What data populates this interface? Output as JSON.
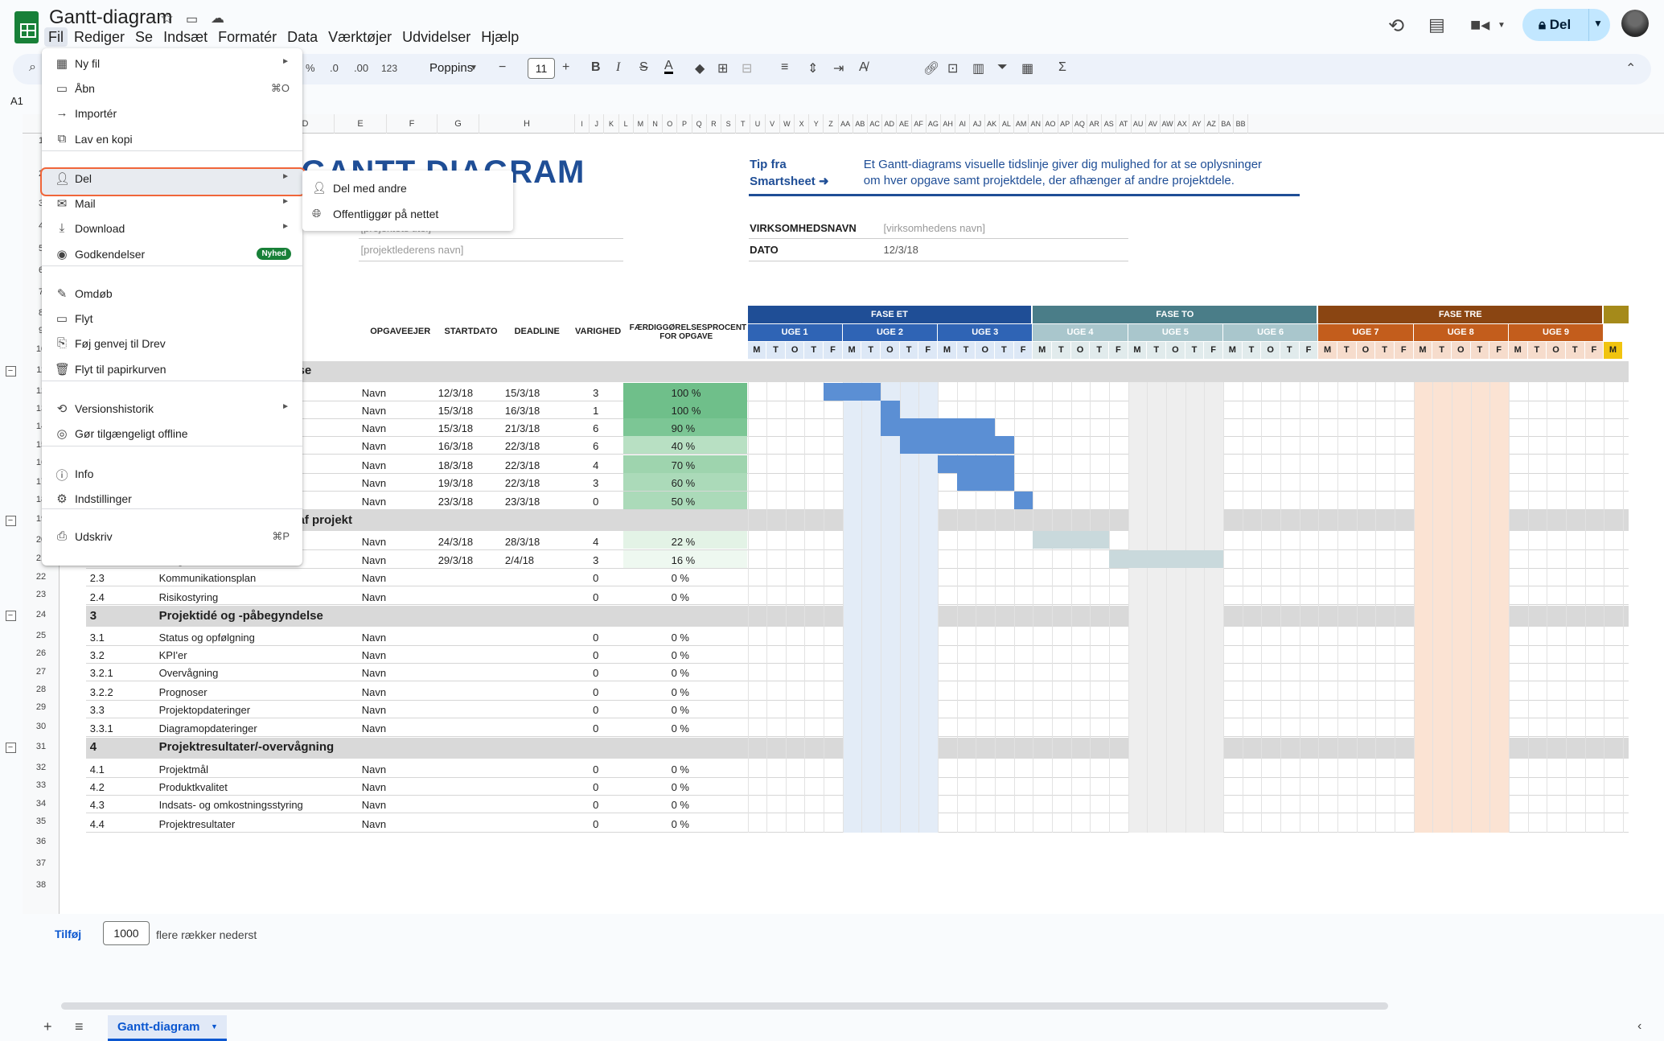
{
  "doc": {
    "title": "Gantt-diagram"
  },
  "menubar": [
    "Fil",
    "Rediger",
    "Se",
    "Indsæt",
    "Formatér",
    "Data",
    "Værktøjer",
    "Udvidelser",
    "Hjælp"
  ],
  "share": {
    "label": "Del"
  },
  "toolbar": {
    "percent": "%",
    "dec_less": ".0",
    "dec_more": ".00",
    "num": "123",
    "font": "Poppins",
    "size": "11",
    "minus": "−",
    "plus": "+"
  },
  "namebox": "A1",
  "columns": [
    "D",
    "E",
    "F",
    "G",
    "H",
    "I",
    "J",
    "K",
    "L",
    "M",
    "N",
    "O",
    "P",
    "Q",
    "R",
    "S",
    "T",
    "U",
    "V",
    "W",
    "X",
    "Y",
    "Z",
    "AA",
    "AB",
    "AC",
    "AD",
    "AE",
    "AF",
    "AG",
    "AH",
    "AI",
    "AJ",
    "AK",
    "AL",
    "AM",
    "AN",
    "AO",
    "AP",
    "AQ",
    "AR",
    "AS",
    "AT",
    "AU",
    "AV",
    "AW",
    "AX",
    "AY",
    "AZ",
    "BA",
    "BB"
  ],
  "sheet": {
    "title": "GANTT-DIAGRAM",
    "tip": {
      "line1": "Tip fra",
      "line2": "Smartsheet ➜",
      "text1": "Et Gantt-diagrams visuelle tidslinje giver dig mulighed for at se oplysninger",
      "text2": "om hver opgave samt projektdele, der afhænger af andre projektdele."
    },
    "proj_title_ph": "[projektets titel]",
    "proj_lead_ph": "[projektlederens navn]",
    "company_label": "VIRKSOMHEDSNAVN",
    "company_ph": "[virksomhedens navn]",
    "date_label": "DATO",
    "date_val": "12/3/18",
    "headers": {
      "owner": "OPGAVEEJER",
      "start": "STARTDATO",
      "deadline": "DEADLINE",
      "duration": "VARIGHED",
      "pct1": "FÆRDIGGØRELSESPROCENT",
      "pct2": "FOR OPGAVE"
    },
    "sec1_tail": "se",
    "sec2_tail": "af projekt",
    "rows_sec1": [
      {
        "owner": "Navn",
        "start": "12/3/18",
        "end": "15/3/18",
        "dur": "3",
        "pct": "100 %"
      },
      {
        "owner": "Navn",
        "start": "15/3/18",
        "end": "16/3/18",
        "dur": "1",
        "pct": "100 %"
      },
      {
        "owner": "Navn",
        "start": "15/3/18",
        "end": "21/3/18",
        "dur": "6",
        "pct": "90 %"
      },
      {
        "owner": "Navn",
        "start": "16/3/18",
        "end": "22/3/18",
        "dur": "6",
        "pct": "40 %"
      },
      {
        "owner": "Navn",
        "start": "18/3/18",
        "end": "22/3/18",
        "dur": "4",
        "pct": "70 %"
      },
      {
        "owner": "Navn",
        "start": "19/3/18",
        "end": "22/3/18",
        "dur": "3",
        "pct": "60 %"
      },
      {
        "owner": "Navn",
        "start": "23/3/18",
        "end": "23/3/18",
        "dur": "0",
        "pct": "50 %"
      }
    ],
    "rows_sec2": [
      {
        "id": "",
        "task": "",
        "owner": "Navn",
        "start": "24/3/18",
        "end": "28/3/18",
        "dur": "4",
        "pct": "22 %"
      },
      {
        "id": "2.2",
        "task": "Budget",
        "owner": "Navn",
        "start": "29/3/18",
        "end": "2/4/18",
        "dur": "3",
        "pct": "16 %"
      },
      {
        "id": "2.3",
        "task": "Kommunikationsplan",
        "owner": "Navn",
        "start": "",
        "end": "",
        "dur": "0",
        "pct": "0 %"
      },
      {
        "id": "2.4",
        "task": "Risikostyring",
        "owner": "Navn",
        "start": "",
        "end": "",
        "dur": "0",
        "pct": "0 %"
      }
    ],
    "sec3": {
      "id": "3",
      "name": "Projektidé og -påbegyndelse"
    },
    "rows_sec3": [
      {
        "id": "3.1",
        "task": "Status og opfølgning",
        "owner": "Navn",
        "dur": "0",
        "pct": "0 %"
      },
      {
        "id": "3.2",
        "task": "KPI'er",
        "owner": "Navn",
        "dur": "0",
        "pct": "0 %"
      },
      {
        "id": "3.2.1",
        "task": "Overvågning",
        "owner": "Navn",
        "dur": "0",
        "pct": "0 %"
      },
      {
        "id": "3.2.2",
        "task": "Prognoser",
        "owner": "Navn",
        "dur": "0",
        "pct": "0 %"
      },
      {
        "id": "3.3",
        "task": "Projektopdateringer",
        "owner": "Navn",
        "dur": "0",
        "pct": "0 %"
      },
      {
        "id": "3.3.1",
        "task": "Diagramopdateringer",
        "owner": "Navn",
        "dur": "0",
        "pct": "0 %"
      }
    ],
    "sec4": {
      "id": "4",
      "name": "Projektresultater/-overvågning"
    },
    "rows_sec4": [
      {
        "id": "4.1",
        "task": "Projektmål",
        "owner": "Navn",
        "dur": "0",
        "pct": "0 %"
      },
      {
        "id": "4.2",
        "task": "Produktkvalitet",
        "owner": "Navn",
        "dur": "0",
        "pct": "0 %"
      },
      {
        "id": "4.3",
        "task": "Indsats- og omkostningsstyring",
        "owner": "Navn",
        "dur": "0",
        "pct": "0 %"
      },
      {
        "id": "4.4",
        "task": "Projektresultater",
        "owner": "Navn",
        "dur": "0",
        "pct": "0 %"
      }
    ],
    "phases": [
      {
        "name": "FASE ET",
        "color": "#1f4e96"
      },
      {
        "name": "FASE TO",
        "color": "#4a7d88"
      },
      {
        "name": "FASE TRE",
        "color": "#8a4512"
      }
    ],
    "weeks": [
      "UGE 1",
      "UGE 2",
      "UGE 3",
      "UGE 4",
      "UGE 5",
      "UGE 6",
      "UGE 7",
      "UGE 8",
      "UGE 9"
    ],
    "week_colors": [
      "#2f64b5",
      "#2f64b5",
      "#2f64b5",
      "#a9c6cc",
      "#a9c6cc",
      "#a9c6cc",
      "#c35d1c",
      "#c35d1c",
      "#c35d1c"
    ],
    "days": [
      "M",
      "T",
      "O",
      "T",
      "F",
      "M",
      "T",
      "O",
      "T",
      "F",
      "M",
      "T",
      "O",
      "T",
      "F",
      "M",
      "T",
      "O",
      "T",
      "F",
      "M",
      "T",
      "O",
      "T",
      "F",
      "M",
      "T",
      "O",
      "T",
      "F",
      "M",
      "T",
      "O",
      "T",
      "F",
      "M",
      "T",
      "O",
      "T",
      "F",
      "M",
      "T",
      "O",
      "T",
      "F",
      "M"
    ]
  },
  "filemenu": {
    "items": [
      {
        "icon": "grid-icon",
        "label": "Ny fil",
        "arrow": true
      },
      {
        "icon": "folder-icon",
        "label": "Åbn",
        "shortcut": "⌘O"
      },
      {
        "icon": "import-icon",
        "label": "Importér"
      },
      {
        "icon": "copy-icon",
        "label": "Lav en kopi"
      },
      {
        "icon": "person-add-icon",
        "label": "Del",
        "arrow": true
      },
      {
        "icon": "mail-icon",
        "label": "Mail",
        "arrow": true
      },
      {
        "icon": "download-icon",
        "label": "Download",
        "arrow": true
      },
      {
        "icon": "approval-icon",
        "label": "Godkendelser",
        "badge": "Nyhed"
      },
      {
        "icon": "rename-icon",
        "label": "Omdøb"
      },
      {
        "icon": "move-icon",
        "label": "Flyt"
      },
      {
        "icon": "drive-shortcut-icon",
        "label": "Føj genvej til Drev"
      },
      {
        "icon": "trash-icon",
        "label": "Flyt til papirkurven"
      },
      {
        "icon": "history-icon",
        "label": "Versionshistorik",
        "arrow": true
      },
      {
        "icon": "offline-icon",
        "label": "Gør tilgængeligt offline"
      },
      {
        "icon": "info-icon",
        "label": "Info"
      },
      {
        "icon": "settings-icon",
        "label": "Indstillinger"
      },
      {
        "icon": "print-icon",
        "label": "Udskriv",
        "shortcut": "⌘P"
      }
    ],
    "arrow_glyph": "►"
  },
  "submenu": [
    {
      "label": "Del med andre"
    },
    {
      "label": "Offentliggør på nettet"
    }
  ],
  "bottom": {
    "add": "Tilføj",
    "count": "1000",
    "text": "flere rækker nederst"
  },
  "sheet_tab": "Gantt-diagram"
}
